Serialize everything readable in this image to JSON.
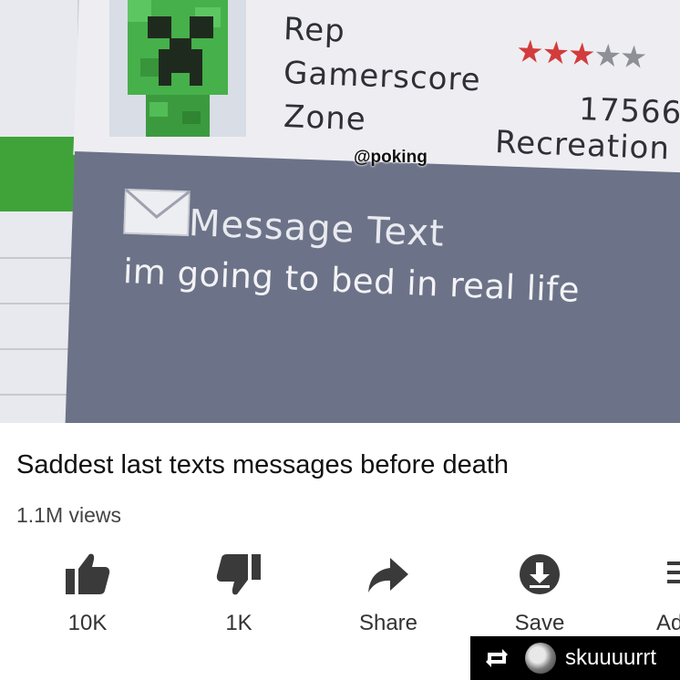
{
  "profile": {
    "rep_label": "Rep",
    "gamerscore_label": "Gamerscore",
    "zone_label": "Zone",
    "gamerscore_value": "17566",
    "zone_value": "Recreation",
    "rep_stars_filled": 3,
    "rep_stars_total": 5
  },
  "watermark": "@poking",
  "message": {
    "title": "Message Text",
    "body": "im going to bed in real life"
  },
  "video": {
    "title": "Saddest last texts messages before death",
    "views": "1.1M views"
  },
  "actions": [
    {
      "label": "10K",
      "icon": "thumbs-up-icon"
    },
    {
      "label": "1K",
      "icon": "thumbs-down-icon"
    },
    {
      "label": "Share",
      "icon": "share-arrow-icon"
    },
    {
      "label": "Save",
      "icon": "download-circle-icon"
    },
    {
      "label": "Ad",
      "icon": "add-to-playlist-icon"
    }
  ],
  "repost": {
    "username": "skuuuurrt",
    "icon": "repost-icon"
  },
  "colors": {
    "star_on": "#d23c3c",
    "star_off": "#8e8f97",
    "creeper_green": "#3fa33a",
    "message_panel": "#6c7388"
  }
}
